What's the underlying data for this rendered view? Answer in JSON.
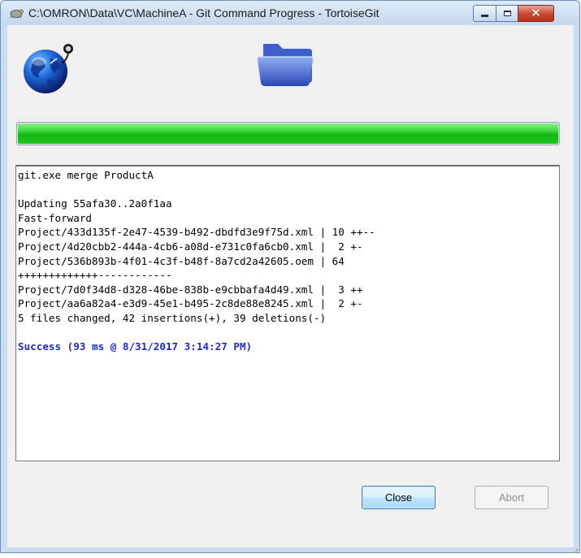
{
  "window": {
    "title": "C:\\OMRON\\Data\\VC\\MachineA - Git Command Progress - TortoiseGit",
    "icons": [
      "tortoisegit-icon",
      "minimize-icon",
      "maximize-icon",
      "close-icon"
    ]
  },
  "header": {
    "left_icon": "globe-network-icon",
    "right_icon": "folder-icon"
  },
  "progress": {
    "value": 1.0
  },
  "log": {
    "lines": [
      {
        "text": "git.exe merge ProductA",
        "style": "normal"
      },
      {
        "text": "",
        "style": "normal"
      },
      {
        "text": "Updating 55afa30..2a0f1aa",
        "style": "normal"
      },
      {
        "text": "Fast-forward",
        "style": "normal"
      },
      {
        "text": "Project/433d135f-2e47-4539-b492-dbdfd3e9f75d.xml | 10 ++--",
        "style": "normal"
      },
      {
        "text": "Project/4d20cbb2-444a-4cb6-a08d-e731c0fa6cb0.xml |  2 +-",
        "style": "normal"
      },
      {
        "text": "Project/536b893b-4f01-4c3f-b48f-8a7cd2a42605.oem | 64",
        "style": "normal"
      },
      {
        "text": "+++++++++++++------------",
        "style": "normal"
      },
      {
        "text": "Project/7d0f34d8-d328-46be-838b-e9cbbafa4d49.xml |  3 ++",
        "style": "normal"
      },
      {
        "text": "Project/aa6a82a4-e3d9-45e1-b495-2c8de88e8245.xml |  2 +-",
        "style": "normal"
      },
      {
        "text": "5 files changed, 42 insertions(+), 39 deletions(-)",
        "style": "normal"
      },
      {
        "text": "",
        "style": "normal"
      },
      {
        "text": "Success (93 ms @ 8/31/2017 3:14:27 PM)",
        "style": "success"
      }
    ]
  },
  "buttons": {
    "close_label": "Close",
    "abort_label": "Abort"
  },
  "colors": {
    "success_text": "#1c2ccc",
    "progress_fill": "#1fc81f",
    "close_button_bg": "#bee6fd",
    "title_close_bg": "#c7452d"
  }
}
